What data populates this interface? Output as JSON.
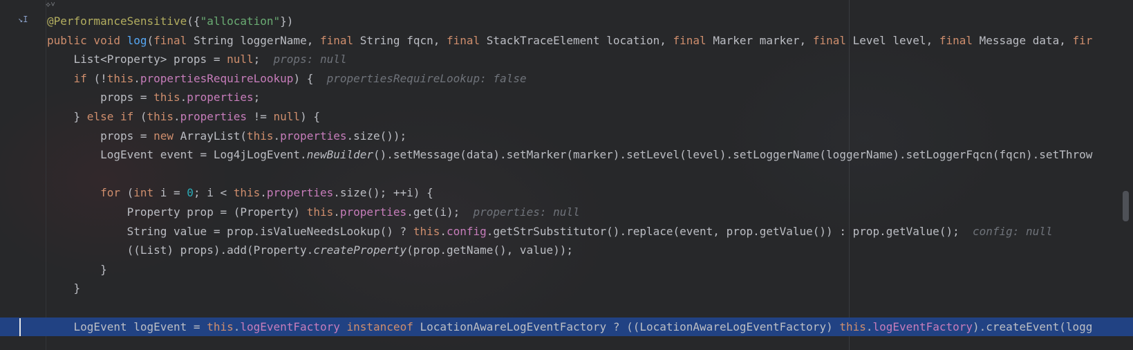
{
  "editor": {
    "ai_hint": "⟡˅",
    "gutter_icon": "↘I",
    "lines": [
      {
        "indent": "",
        "segments": [
          {
            "t": "@PerformanceSensitive",
            "c": "ann"
          },
          {
            "t": "({",
            "c": ""
          },
          {
            "t": "\"allocation\"",
            "c": "str"
          },
          {
            "t": "})",
            "c": ""
          }
        ]
      },
      {
        "indent": "",
        "segments": [
          {
            "t": "public void ",
            "c": "kw"
          },
          {
            "t": "log",
            "c": "fn"
          },
          {
            "t": "(",
            "c": ""
          },
          {
            "t": "final ",
            "c": "kw"
          },
          {
            "t": "String loggerName, ",
            "c": ""
          },
          {
            "t": "final ",
            "c": "kw"
          },
          {
            "t": "String fqcn, ",
            "c": ""
          },
          {
            "t": "final ",
            "c": "kw"
          },
          {
            "t": "StackTraceElement location, ",
            "c": ""
          },
          {
            "t": "final ",
            "c": "kw"
          },
          {
            "t": "Marker marker, ",
            "c": ""
          },
          {
            "t": "final ",
            "c": "kw"
          },
          {
            "t": "Level level, ",
            "c": ""
          },
          {
            "t": "final ",
            "c": "kw"
          },
          {
            "t": "Message data, ",
            "c": ""
          },
          {
            "t": "fir",
            "c": "kw"
          }
        ]
      },
      {
        "indent": "    ",
        "segments": [
          {
            "t": "List<Property> props = ",
            "c": ""
          },
          {
            "t": "null",
            "c": "kw"
          },
          {
            "t": ";  ",
            "c": ""
          },
          {
            "t": "props: null",
            "c": "hint"
          }
        ]
      },
      {
        "indent": "    ",
        "segments": [
          {
            "t": "if ",
            "c": "kw"
          },
          {
            "t": "(!",
            "c": ""
          },
          {
            "t": "this",
            "c": "kw"
          },
          {
            "t": ".",
            "c": ""
          },
          {
            "t": "propertiesRequireLookup",
            "c": "field"
          },
          {
            "t": ") {  ",
            "c": ""
          },
          {
            "t": "propertiesRequireLookup: false",
            "c": "hint"
          }
        ]
      },
      {
        "indent": "        ",
        "segments": [
          {
            "t": "props = ",
            "c": ""
          },
          {
            "t": "this",
            "c": "kw"
          },
          {
            "t": ".",
            "c": ""
          },
          {
            "t": "properties",
            "c": "field"
          },
          {
            "t": ";",
            "c": ""
          }
        ]
      },
      {
        "indent": "    ",
        "segments": [
          {
            "t": "} ",
            "c": ""
          },
          {
            "t": "else if ",
            "c": "kw"
          },
          {
            "t": "(",
            "c": ""
          },
          {
            "t": "this",
            "c": "kw"
          },
          {
            "t": ".",
            "c": ""
          },
          {
            "t": "properties",
            "c": "field"
          },
          {
            "t": " != ",
            "c": ""
          },
          {
            "t": "null",
            "c": "kw"
          },
          {
            "t": ") {",
            "c": ""
          }
        ]
      },
      {
        "indent": "        ",
        "segments": [
          {
            "t": "props = ",
            "c": ""
          },
          {
            "t": "new ",
            "c": "kw"
          },
          {
            "t": "ArrayList(",
            "c": ""
          },
          {
            "t": "this",
            "c": "kw"
          },
          {
            "t": ".",
            "c": ""
          },
          {
            "t": "properties",
            "c": "field"
          },
          {
            "t": ".size());",
            "c": ""
          }
        ]
      },
      {
        "indent": "        ",
        "segments": [
          {
            "t": "LogEvent event = Log4jLogEvent.",
            "c": ""
          },
          {
            "t": "newBuilder",
            "c": "it"
          },
          {
            "t": "().setMessage(data).setMarker(marker).setLevel(level).setLoggerName(loggerName).setLoggerFqcn(fqcn).setThrow",
            "c": ""
          }
        ]
      },
      {
        "indent": "",
        "segments": []
      },
      {
        "indent": "        ",
        "segments": [
          {
            "t": "for ",
            "c": "kw"
          },
          {
            "t": "(",
            "c": ""
          },
          {
            "t": "int ",
            "c": "kw"
          },
          {
            "t": "i = ",
            "c": ""
          },
          {
            "t": "0",
            "c": "num"
          },
          {
            "t": "; i < ",
            "c": ""
          },
          {
            "t": "this",
            "c": "kw"
          },
          {
            "t": ".",
            "c": ""
          },
          {
            "t": "properties",
            "c": "field"
          },
          {
            "t": ".size(); ++i) {",
            "c": ""
          }
        ]
      },
      {
        "indent": "            ",
        "segments": [
          {
            "t": "Property prop = (Property) ",
            "c": ""
          },
          {
            "t": "this",
            "c": "kw"
          },
          {
            "t": ".",
            "c": ""
          },
          {
            "t": "properties",
            "c": "field"
          },
          {
            "t": ".get(i);  ",
            "c": ""
          },
          {
            "t": "properties: null",
            "c": "hint"
          }
        ]
      },
      {
        "indent": "            ",
        "segments": [
          {
            "t": "String value = prop.isValueNeedsLookup() ? ",
            "c": ""
          },
          {
            "t": "this",
            "c": "kw"
          },
          {
            "t": ".",
            "c": ""
          },
          {
            "t": "config",
            "c": "field"
          },
          {
            "t": ".getStrSubstitutor().replace(event, prop.getValue()) : prop.getValue();  ",
            "c": ""
          },
          {
            "t": "config: null",
            "c": "hint"
          }
        ]
      },
      {
        "indent": "            ",
        "segments": [
          {
            "t": "((List) props).add(Property.",
            "c": ""
          },
          {
            "t": "createProperty",
            "c": "it"
          },
          {
            "t": "(prop.getName(), value));",
            "c": ""
          }
        ]
      },
      {
        "indent": "        ",
        "segments": [
          {
            "t": "}",
            "c": ""
          }
        ]
      },
      {
        "indent": "    ",
        "segments": [
          {
            "t": "}",
            "c": ""
          }
        ]
      },
      {
        "indent": "",
        "segments": []
      },
      {
        "indent": "    ",
        "selected": true,
        "segments": [
          {
            "t": "LogEvent logEvent = ",
            "c": ""
          },
          {
            "t": "this",
            "c": "kw"
          },
          {
            "t": ".",
            "c": ""
          },
          {
            "t": "logEventFactory",
            "c": "field"
          },
          {
            "t": " ",
            "c": ""
          },
          {
            "t": "instanceof ",
            "c": "kw"
          },
          {
            "t": "LocationAwareLogEventFactory ? ((LocationAwareLogEventFactory) ",
            "c": ""
          },
          {
            "t": "this",
            "c": "kw"
          },
          {
            "t": ".",
            "c": ""
          },
          {
            "t": "logEventFactory",
            "c": "field"
          },
          {
            "t": ").createEvent(logg",
            "c": ""
          }
        ]
      }
    ]
  }
}
